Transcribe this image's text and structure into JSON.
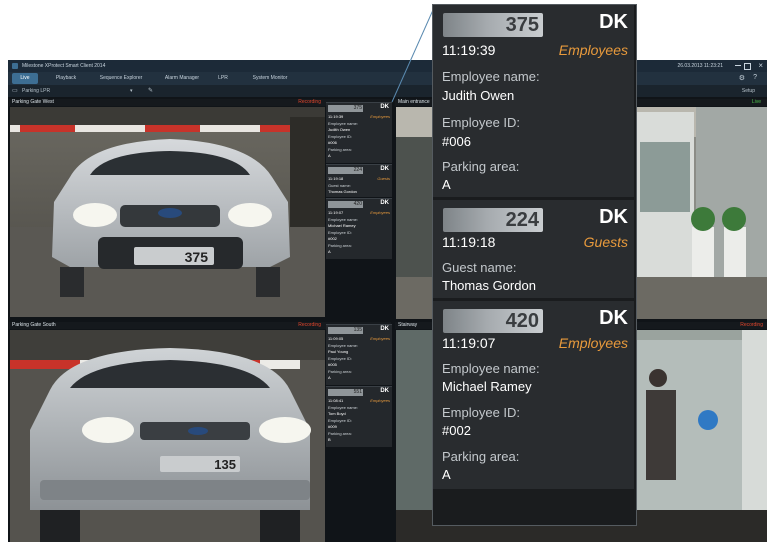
{
  "app": {
    "title": "Milestone XProtect Smart Client 2014",
    "clock": "26.03.2013 11:23:21",
    "tabs": [
      "Live",
      "Playback",
      "Sequence Explorer",
      "Alarm Manager",
      "LPR",
      "System Monitor"
    ],
    "toolbar": {
      "view_name": "Parking LPR",
      "setup_label": "Setup"
    }
  },
  "cameras": {
    "top_left": {
      "title": "Parking Gate West",
      "status": "Recording"
    },
    "top_right": {
      "title": "Main entrance",
      "status": "Live"
    },
    "bottom_left": {
      "title": "Parking Gate South",
      "status": "Recording"
    },
    "bottom_right": {
      "title": "Stairway",
      "status": "Recording"
    }
  },
  "scene_plates": {
    "top_left": "375",
    "bottom_left": "135"
  },
  "mini_results": [
    {
      "plate": "375",
      "country": "DK",
      "time": "11:19:39",
      "group": "Employees",
      "lines": [
        "Employee name:",
        "Judith Owen",
        "Employee ID:",
        "#006",
        "Parking area:",
        "A"
      ]
    },
    {
      "plate": "224",
      "country": "DK",
      "time": "11:19:18",
      "group": "Guests",
      "lines": [
        "Guest name:",
        "Thomas Gordon"
      ]
    },
    {
      "plate": "420",
      "country": "DK",
      "time": "11:19:07",
      "group": "Employees",
      "lines": [
        "Employee name:",
        "Michael Ramey",
        "Employee ID:",
        "#002",
        "Parking area:",
        "A"
      ]
    },
    {
      "plate": "135",
      "country": "DK",
      "time": "11:09:05",
      "group": "Employees",
      "lines": [
        "Employee name:",
        "Paul Young",
        "Employee ID:",
        "#005",
        "Parking area:",
        "A"
      ]
    },
    {
      "plate": "551",
      "country": "DK",
      "time": "11:08:41",
      "group": "Employees",
      "lines": [
        "Employee name:",
        "Tom Boyd",
        "Employee ID:",
        "#009",
        "Parking area:",
        "B"
      ]
    }
  ],
  "zoom_results": [
    {
      "plate": "375",
      "country": "DK",
      "time": "11:19:39",
      "group": "Employees",
      "fields": [
        {
          "label": "Employee name:",
          "value": "Judith Owen"
        },
        {
          "label": "Employee ID:",
          "value": "#006"
        },
        {
          "label": "Parking area:",
          "value": "A"
        }
      ]
    },
    {
      "plate": "224",
      "country": "DK",
      "time": "11:19:18",
      "group": "Guests",
      "fields": [
        {
          "label": "Guest name:",
          "value": "Thomas Gordon"
        }
      ]
    },
    {
      "plate": "420",
      "country": "DK",
      "time": "11:19:07",
      "group": "Employees",
      "fields": [
        {
          "label": "Employee name:",
          "value": "Michael Ramey"
        },
        {
          "label": "Employee ID:",
          "value": "#002"
        },
        {
          "label": "Parking area:",
          "value": "A"
        }
      ]
    }
  ],
  "colors": {
    "accent": "#e89a3c",
    "recording": "#e0452c",
    "live": "#4fbf4f",
    "active_tab": "#3d6e93"
  }
}
